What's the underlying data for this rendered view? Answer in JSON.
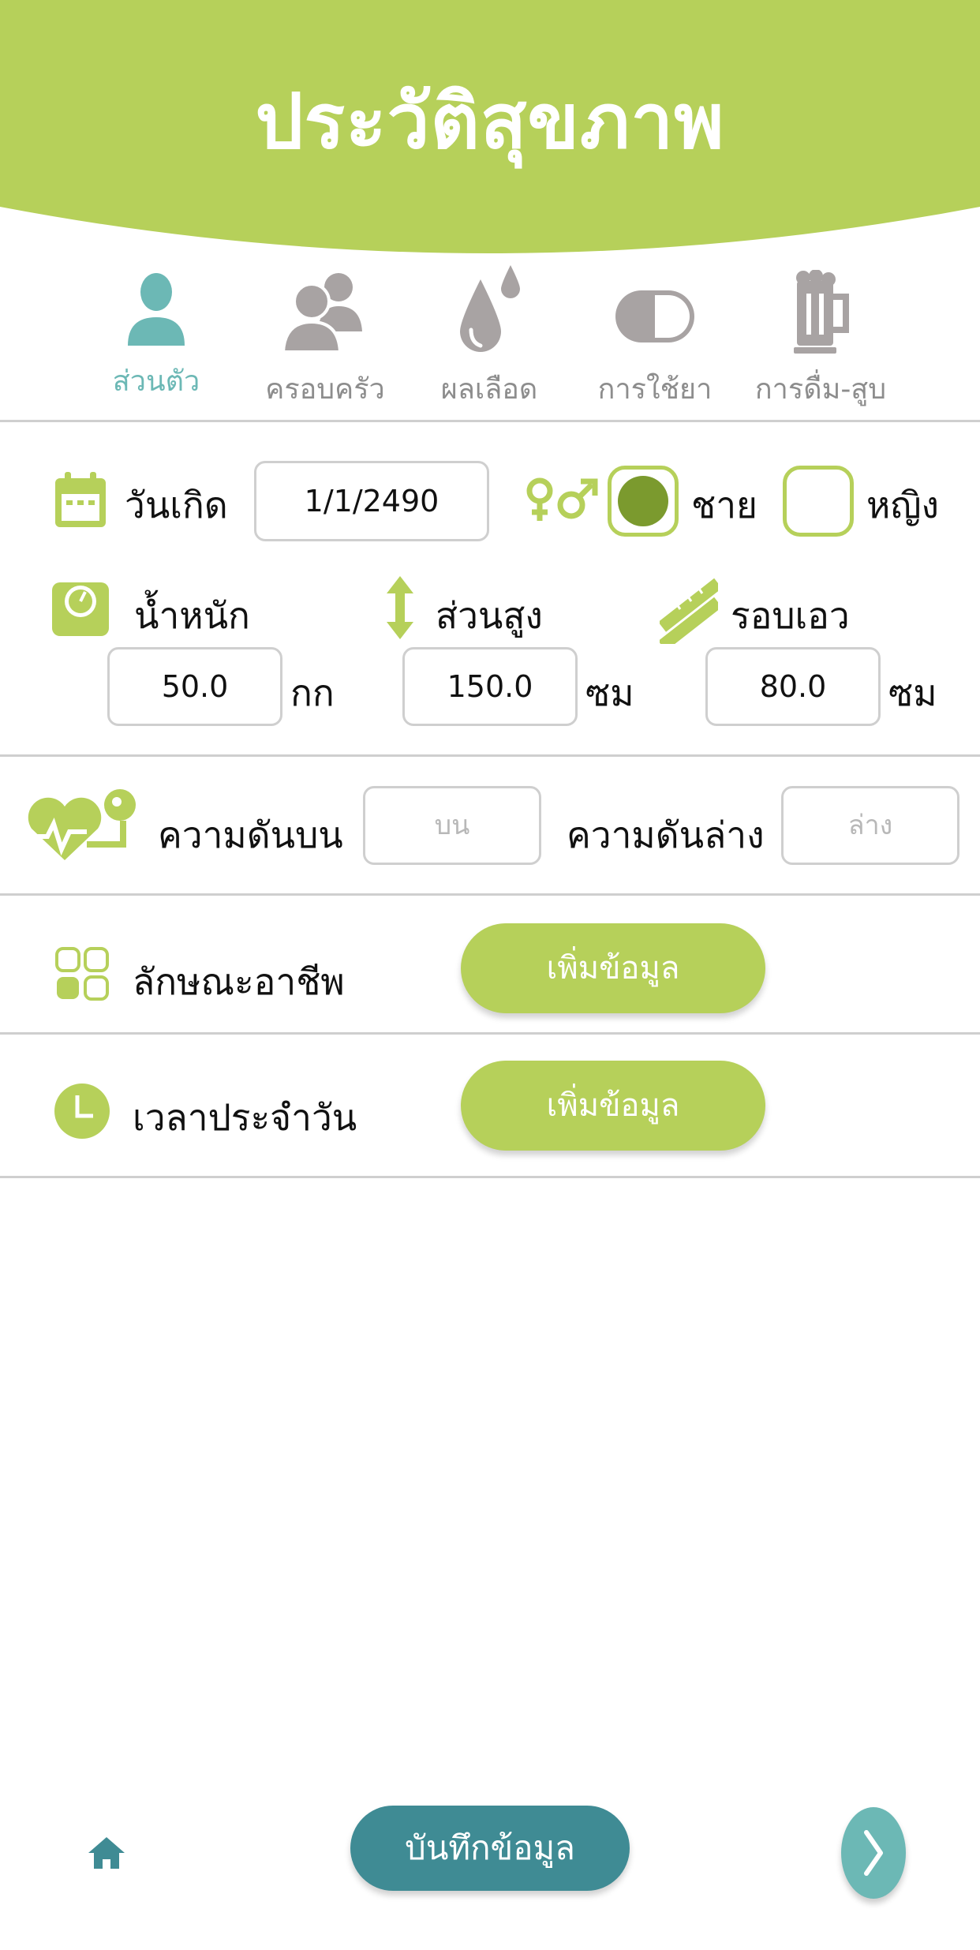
{
  "header": {
    "title": "ประวัติสุขภาพ"
  },
  "tabs": [
    {
      "label": "ส่วนตัว",
      "icon": "person-icon",
      "active": true
    },
    {
      "label": "ครอบครัว",
      "icon": "family-icon",
      "active": false
    },
    {
      "label": "ผลเลือด",
      "icon": "blood-drop-icon",
      "active": false
    },
    {
      "label": "การใช้ยา",
      "icon": "pill-icon",
      "active": false
    },
    {
      "label": "การดื่ม-สูบ",
      "icon": "beer-mug-icon",
      "active": false
    }
  ],
  "birthdate": {
    "label": "วันเกิด",
    "value": "1/1/2490"
  },
  "gender": {
    "male_label": "ชาย",
    "female_label": "หญิง",
    "selected": "male"
  },
  "weight": {
    "label": "น้ำหนัก",
    "value": "50.0",
    "unit": "กก"
  },
  "height": {
    "label": "ส่วนสูง",
    "value": "150.0",
    "unit": "ซม"
  },
  "waist": {
    "label": "รอบเอว",
    "value": "80.0",
    "unit": "ซม"
  },
  "blood_pressure": {
    "upper_label": "ความดันบน",
    "upper_placeholder": "บน",
    "lower_label": "ความดันล่าง",
    "lower_placeholder": "ล่าง"
  },
  "occupation": {
    "label": "ลักษณะอาชีพ",
    "button": "เพิ่มข้อมูล"
  },
  "daily_time": {
    "label": "เวลาประจำวัน",
    "button": "เพิ่มข้อมูล"
  },
  "footer": {
    "save_label": "บันทึกข้อมูล"
  },
  "colors": {
    "accent_green": "#b6d05a",
    "teal": "#6cb8b5",
    "dark_teal": "#3f8b94",
    "icon_gray": "#a8a3a3"
  }
}
